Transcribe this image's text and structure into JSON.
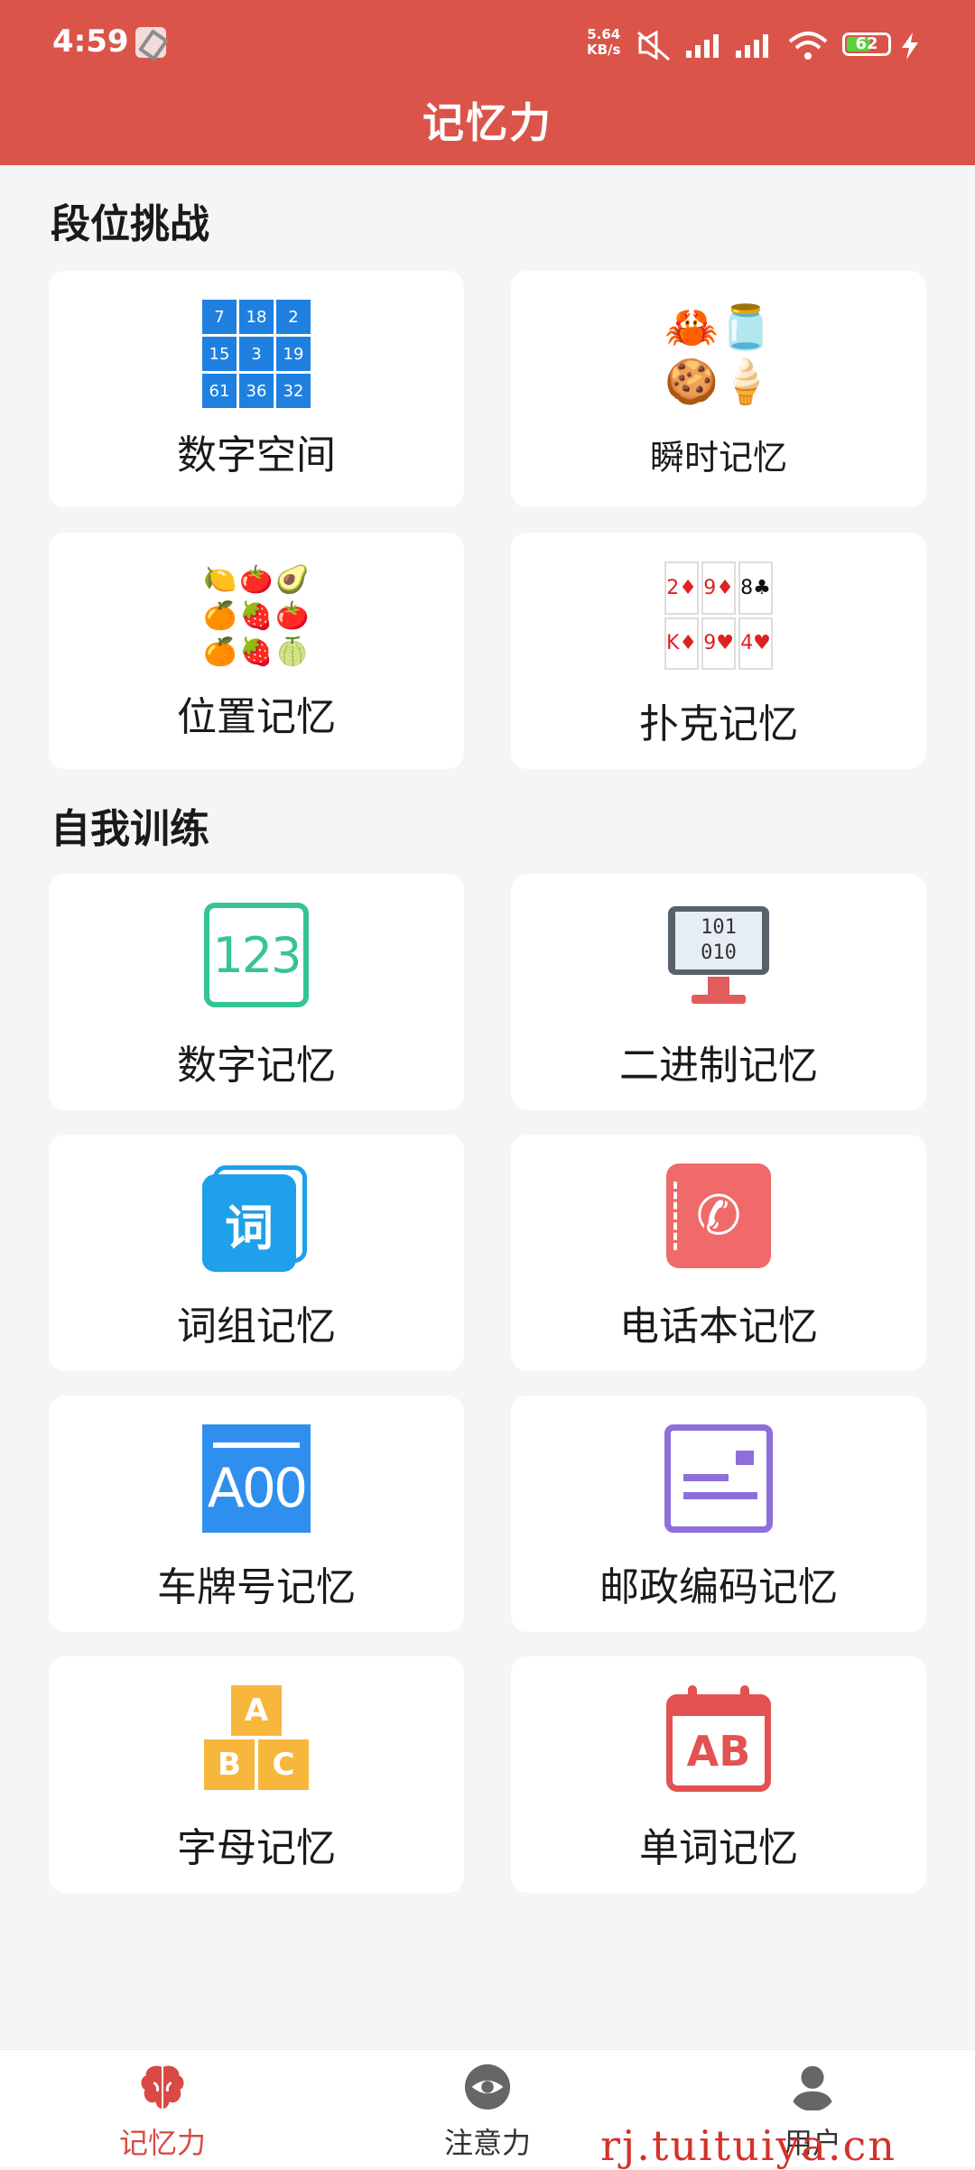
{
  "status_bar": {
    "time": "4:59",
    "speed_value": "5.64",
    "speed_unit": "KB/s",
    "battery": "62",
    "battery_level": 0.62
  },
  "header": {
    "title": "记忆力"
  },
  "section_challenge": {
    "title": "段位挑战",
    "items": [
      {
        "label": "数字空间",
        "grid": [
          "7",
          "18",
          "2",
          "15",
          "3",
          "19",
          "61",
          "36",
          "32"
        ]
      },
      {
        "label": "瞬时记忆",
        "emojis": [
          "🦀",
          "🫙",
          "🍪",
          "🍦"
        ]
      },
      {
        "label": "位置记忆",
        "emojis": [
          "🍋",
          "🍅",
          "🥑",
          "🍊",
          "🍓",
          "🍅",
          "🍊",
          "🍓",
          "🍈"
        ]
      },
      {
        "label": "扑克记忆",
        "cards": [
          "2♦",
          "9♦",
          "8♣",
          "K♦",
          "9♥",
          "4♥"
        ]
      }
    ]
  },
  "section_training": {
    "title": "自我训练",
    "items": [
      {
        "label": "数字记忆",
        "icon_text": "123"
      },
      {
        "label": "二进制记忆",
        "icon_text": "101\n010"
      },
      {
        "label": "词组记忆",
        "icon_text": "词"
      },
      {
        "label": "电话本记忆",
        "icon_text": "✆"
      },
      {
        "label": "车牌号记忆",
        "icon_text": "A00"
      },
      {
        "label": "邮政编码记忆",
        "icon_text": ""
      },
      {
        "label": "字母记忆",
        "letters": [
          "A",
          "B",
          "C"
        ]
      },
      {
        "label": "单词记忆",
        "icon_text": "AB"
      }
    ]
  },
  "bottom_nav": {
    "items": [
      {
        "label": "记忆力",
        "active": true
      },
      {
        "label": "注意力",
        "active": false
      },
      {
        "label": "用户",
        "active": false
      }
    ],
    "active_color": "#d84a43",
    "inactive_color": "#333333"
  },
  "watermark": "rj.tuituiya.cn",
  "colors": {
    "header": "#db544a",
    "background": "#f5f5f5"
  }
}
